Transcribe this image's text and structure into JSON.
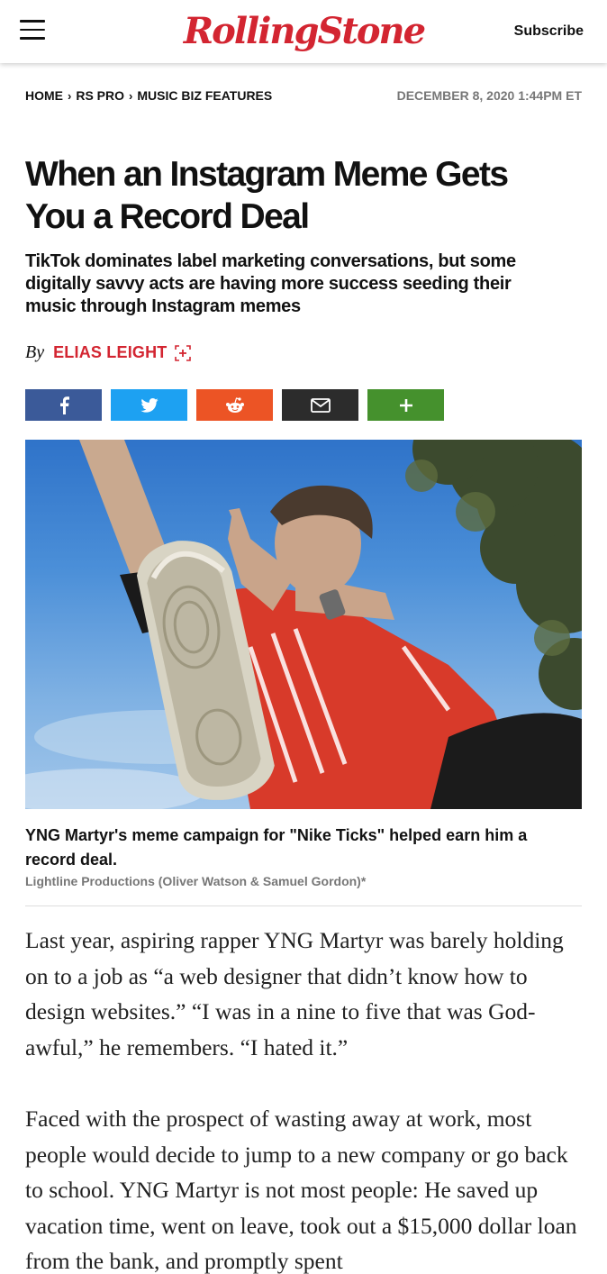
{
  "header": {
    "logo_text": "RollingStone",
    "subscribe_label": "Subscribe",
    "menu_icon": "hamburger-menu-icon",
    "brand_color": "#d32531"
  },
  "breadcrumb": {
    "items": [
      "HOME",
      "RS PRO",
      "MUSIC BIZ FEATURES"
    ],
    "separator_icon": "chevron-right-icon"
  },
  "dateline": "DECEMBER 8, 2020 1:44PM ET",
  "article": {
    "headline": "When an Instagram Meme Gets You a Record Deal",
    "dek": "TikTok dominates label marketing conversations, but some digitally savvy acts are having more success seeding their music through Instagram memes",
    "byline_prefix": "By",
    "author": "ELIAS LEIGHT",
    "author_follow_icon": "follow-plus-icon"
  },
  "share": {
    "buttons": [
      {
        "icon": "facebook-icon",
        "color": "#3b5a99"
      },
      {
        "icon": "twitter-icon",
        "color": "#1da1f2"
      },
      {
        "icon": "reddit-icon",
        "color": "#ec5425"
      },
      {
        "icon": "email-icon",
        "color": "#2c2c2c"
      },
      {
        "icon": "more-plus-icon",
        "color": "#45912d"
      }
    ]
  },
  "photo": {
    "caption": "YNG Martyr's meme campaign for \"Nike Ticks\" helped earn him a record deal.",
    "credit": "Lightline Productions (Oliver Watson & Samuel Gordon)*"
  },
  "body": {
    "paragraphs": [
      "Last year, aspiring rapper YNG Martyr was barely holding on to a job as “a web designer that didn’t know how to design websites.” “I was in a nine to five that was God-awful,” he remembers. “I hated it.”",
      "Faced with the prospect of wasting away at work, most people would decide to jump to a new company or go back to school. YNG Martyr is not most people: He saved up vacation time, went on leave, took out a $15,000 dollar loan from the bank, and promptly spent"
    ]
  }
}
